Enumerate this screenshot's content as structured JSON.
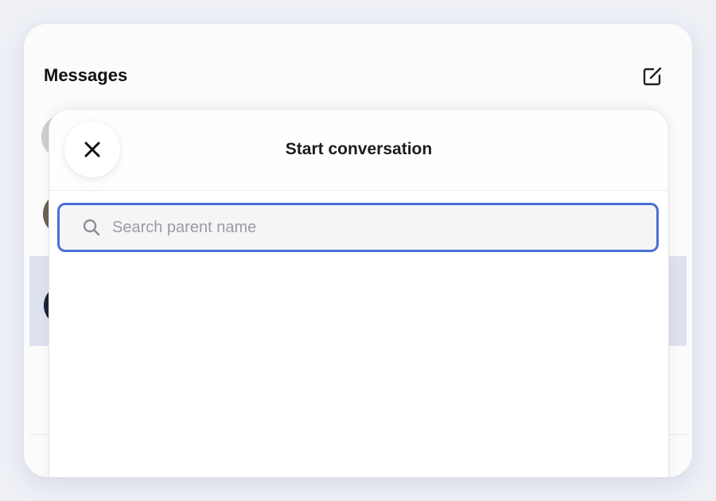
{
  "header": {
    "title": "Messages",
    "compose_icon": "compose-icon"
  },
  "modal": {
    "title": "Start conversation",
    "close_icon": "close-icon",
    "search": {
      "placeholder": "Search parent name",
      "value": "",
      "icon": "search-icon"
    }
  },
  "colors": {
    "focus_border": "#4a6fd6",
    "selected_row": "#dde2ee",
    "page_background": "#eef0f6"
  }
}
